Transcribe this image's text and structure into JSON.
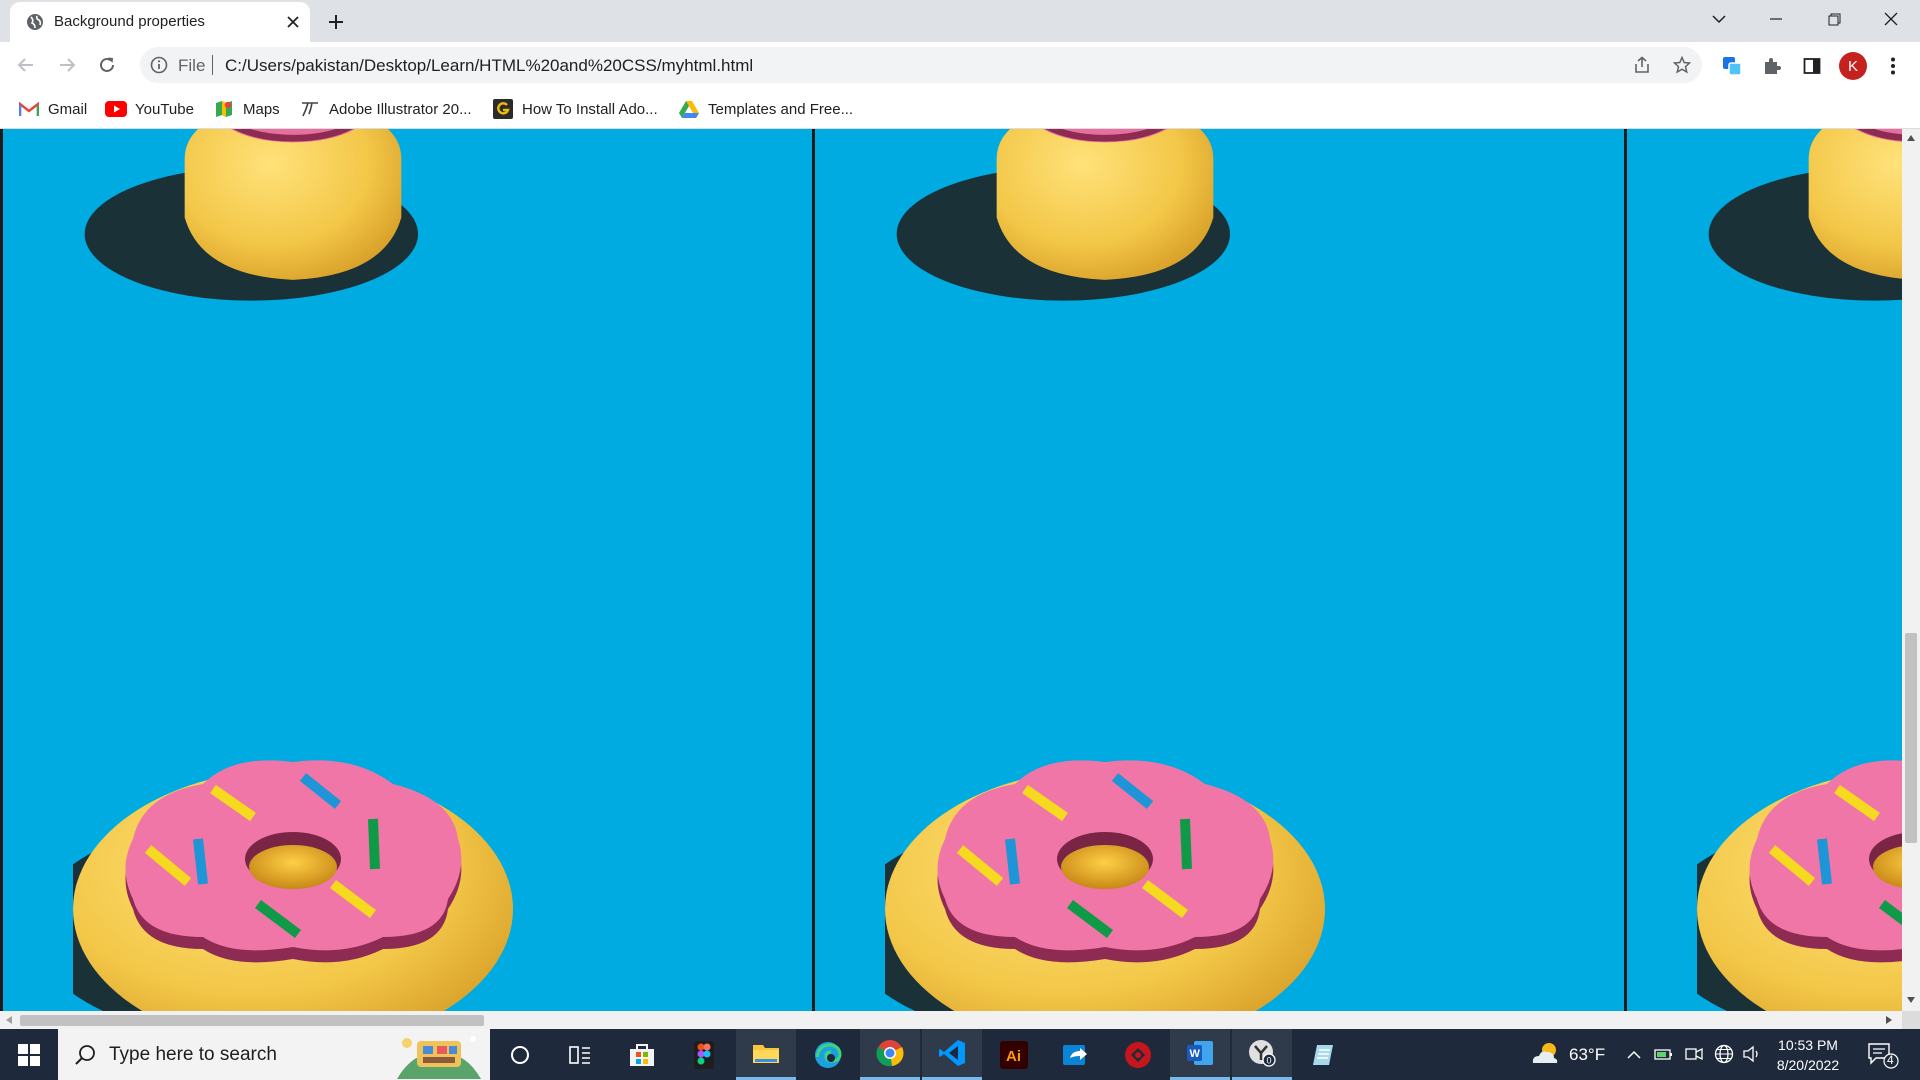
{
  "tab": {
    "title": "Background properties"
  },
  "toolbar": {
    "scheme": "File",
    "url": "C:/Users/pakistan/Desktop/Learn/HTML%20and%20CSS/myhtml.html",
    "profile_initial": "K"
  },
  "bookmarks": [
    {
      "label": "Gmail",
      "icon": "gmail-icon"
    },
    {
      "label": "YouTube",
      "icon": "youtube-icon"
    },
    {
      "label": "Maps",
      "icon": "maps-icon"
    },
    {
      "label": "Adobe Illustrator 20...",
      "icon": "illustrator-bookmark-icon"
    },
    {
      "label": "How To Install Ado...",
      "icon": "g-bookmark-icon"
    },
    {
      "label": "Templates and Free...",
      "icon": "google-drive-icon"
    }
  ],
  "page": {
    "background_color": "#00abe1",
    "tile_image": "donut"
  },
  "taskbar": {
    "search_placeholder": "Type here to search",
    "weather_temp": "63°F",
    "time": "10:53 PM",
    "date": "8/20/2022",
    "notification_count": "4",
    "apps": [
      "cortana-icon",
      "task-view-icon",
      "microsoft-store-icon",
      "figma-icon",
      "file-explorer-icon",
      "edge-icon",
      "chrome-icon",
      "vscode-icon",
      "illustrator-icon",
      "share-app-icon",
      "adblock-icon",
      "word-icon",
      "app-icon-badged",
      "notepad-icon"
    ]
  }
}
